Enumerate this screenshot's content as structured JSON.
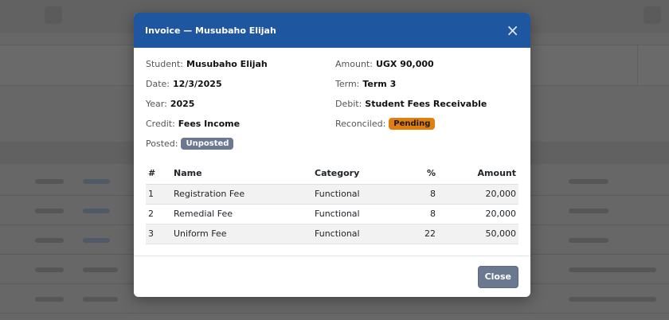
{
  "modal": {
    "title": "Invoice — Musubaho Elijah",
    "close_icon": "×",
    "close_button": "Close"
  },
  "details": {
    "student": {
      "label": "Student:",
      "value": "Musubaho Elijah"
    },
    "amount": {
      "label": "Amount:",
      "value": "UGX 90,000"
    },
    "date": {
      "label": "Date:",
      "value": "12/3/2025"
    },
    "term": {
      "label": "Term:",
      "value": "Term 3"
    },
    "year": {
      "label": "Year:",
      "value": "2025"
    },
    "debit": {
      "label": "Debit:",
      "value": "Student Fees Receivable"
    },
    "credit": {
      "label": "Credit:",
      "value": "Fees Income"
    },
    "reconciled": {
      "label": "Reconciled:",
      "value": "Pending",
      "color": "#e07f0f"
    },
    "posted": {
      "label": "Posted:",
      "value": "Unposted",
      "color": "#6a7890"
    }
  },
  "table": {
    "headers": {
      "num": "#",
      "name": "Name",
      "category": "Category",
      "pct": "%",
      "amount": "Amount"
    },
    "rows": [
      {
        "num": "1",
        "name": "Registration Fee",
        "category": "Functional",
        "pct": "8",
        "amount": "20,000"
      },
      {
        "num": "2",
        "name": "Remedial Fee",
        "category": "Functional",
        "pct": "8",
        "amount": "20,000"
      },
      {
        "num": "3",
        "name": "Uniform Fee",
        "category": "Functional",
        "pct": "22",
        "amount": "50,000"
      }
    ]
  },
  "colors": {
    "header_bg": "#1e56a0",
    "secondary": "#6a7890",
    "warning": "#e07f0f"
  }
}
